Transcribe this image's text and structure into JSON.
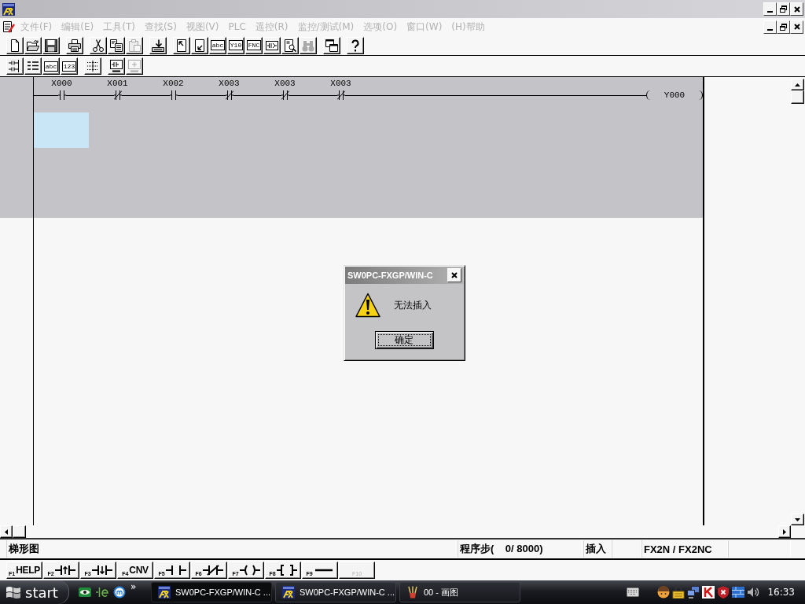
{
  "menu_bar": {
    "items": [
      {
        "label": "文件(F)",
        "disabled": true
      },
      {
        "label": "编辑(E)",
        "disabled": true
      },
      {
        "label": "工具(T)",
        "disabled": true
      },
      {
        "label": "查找(S)",
        "disabled": true
      },
      {
        "label": "视图(V)",
        "disabled": true
      },
      {
        "label": "PLC",
        "disabled": true
      },
      {
        "label": "遥控(R)",
        "disabled": true
      },
      {
        "label": "监控/测试(M)",
        "disabled": true
      },
      {
        "label": "选项(O)",
        "disabled": true
      },
      {
        "label": "窗口(W)",
        "disabled": true
      },
      {
        "label": "(H)帮助",
        "disabled": true
      }
    ]
  },
  "toolbars": [
    {
      "groups": [
        [
          {
            "kind": "new",
            "disabled": false
          },
          {
            "kind": "open",
            "disabled": false
          },
          {
            "kind": "save",
            "disabled": false
          }
        ],
        [
          {
            "kind": "print",
            "disabled": false
          }
        ],
        [
          {
            "kind": "cut",
            "disabled": false
          },
          {
            "kind": "copy",
            "disabled": false
          },
          {
            "kind": "paste",
            "disabled": true
          }
        ],
        [
          {
            "kind": "transfer",
            "disabled": false
          }
        ],
        [
          {
            "kind": "page-up",
            "disabled": false
          },
          {
            "kind": "page-down",
            "disabled": false
          },
          {
            "kind": "label",
            "label": "abc",
            "disabled": false
          },
          {
            "kind": "label",
            "label": "Y10",
            "disabled": false
          },
          {
            "kind": "label",
            "label": "FNC",
            "disabled": false
          },
          {
            "kind": "contact-box",
            "disabled": false
          },
          {
            "kind": "page-search",
            "disabled": false
          },
          {
            "kind": "binoculars",
            "disabled": true
          }
        ],
        [
          {
            "kind": "windows",
            "disabled": false
          }
        ],
        [
          {
            "kind": "help",
            "disabled": false
          }
        ]
      ]
    },
    {
      "groups": [
        [
          {
            "kind": "ladder",
            "disabled": false
          },
          {
            "kind": "list",
            "disabled": false
          },
          {
            "kind": "label",
            "label": "abc",
            "disabled": false
          },
          {
            "kind": "label",
            "label": "123",
            "disabled": false
          }
        ],
        [
          {
            "kind": "grid",
            "disabled": false
          }
        ],
        [
          {
            "kind": "monitor-ladder",
            "disabled": false
          },
          {
            "kind": "monitor",
            "disabled": true
          }
        ]
      ]
    }
  ],
  "ladder": {
    "rungs": [
      {
        "contacts": [
          {
            "label": "X000",
            "kind": "open"
          },
          {
            "label": "X001",
            "kind": "closed"
          },
          {
            "label": "X002",
            "kind": "open"
          },
          {
            "label": "X003",
            "kind": "closed"
          },
          {
            "label": "X003",
            "kind": "closed"
          },
          {
            "label": "X003",
            "kind": "closed"
          }
        ],
        "coil": "Y000"
      }
    ]
  },
  "dialog": {
    "title": "SW0PC-FXGP/WIN-C",
    "message": "无法插入",
    "button": "确定"
  },
  "status_bar": {
    "view": "梯形图",
    "steps": "程序步(    0/ 8000)",
    "mode": "插入",
    "plc_type": "FX2N / FX2NC"
  },
  "function_keys": [
    {
      "key": "F1",
      "kind": "text",
      "label": "HELP",
      "disabled": false
    },
    {
      "key": "F2",
      "kind": "rising",
      "disabled": false
    },
    {
      "key": "F3",
      "kind": "falling",
      "disabled": false
    },
    {
      "key": "F4",
      "kind": "text",
      "label": "CNV",
      "disabled": false
    },
    {
      "key": "F5",
      "kind": "open",
      "disabled": false
    },
    {
      "key": "F6",
      "kind": "closed",
      "disabled": false
    },
    {
      "key": "F7",
      "kind": "coil",
      "disabled": false
    },
    {
      "key": "F8",
      "kind": "instruction",
      "disabled": false
    },
    {
      "key": "F9",
      "kind": "line",
      "disabled": false
    },
    {
      "key": "F10",
      "kind": "blank",
      "disabled": true
    }
  ],
  "taskbar": {
    "start": "start",
    "more": "»",
    "tasks": [
      {
        "title": "SW0PC-FXGP/WIN-C ...",
        "kind": "fx",
        "selected": true
      },
      {
        "title": "SW0PC-FXGP/WIN-C ...",
        "kind": "fx",
        "selected": false
      },
      {
        "title": "00 - 画图",
        "kind": "paint",
        "selected": false
      }
    ],
    "clock": "16:33"
  }
}
